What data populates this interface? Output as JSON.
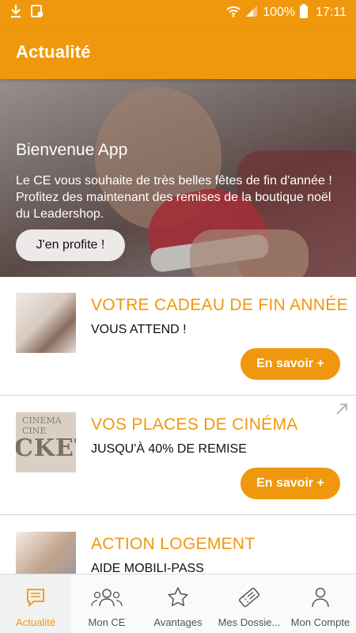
{
  "status_bar": {
    "battery": "100%",
    "time": "17:11"
  },
  "app_bar": {
    "title": "Actualité"
  },
  "hero": {
    "title": "Bienvenue App",
    "text": "Le CE vous souhaite de très belles fêtes de fin d'année ! Profitez des maintenant des remises de la boutique noël du Leadershop.",
    "button_label": "J'en profite !"
  },
  "cards": [
    {
      "title": "VOTRE CADEAU DE FIN ANNÉE",
      "subtitle": "VOUS ATTEND !",
      "button_label": "En savoir +"
    },
    {
      "title": "VOS PLACES DE CINÉMA",
      "subtitle": "JUSQU'À 40% DE REMISE",
      "button_label": "En savoir +",
      "thumb_text_top": "CINEMA CINE",
      "thumb_text": "CKET"
    },
    {
      "title": "ACTION LOGEMENT",
      "subtitle": "AIDE MOBILI-PASS"
    }
  ],
  "bottom_nav": [
    {
      "label": "Actualité",
      "icon": "news-icon",
      "active": true
    },
    {
      "label": "Mon CE",
      "icon": "group-icon"
    },
    {
      "label": "Avantages",
      "icon": "star-icon"
    },
    {
      "label": "Mes Dossie...",
      "icon": "ticket-icon"
    },
    {
      "label": "Mon Compte",
      "icon": "user-icon"
    }
  ],
  "colors": {
    "accent": "#f0980d",
    "nav_inactive": "#555555"
  }
}
